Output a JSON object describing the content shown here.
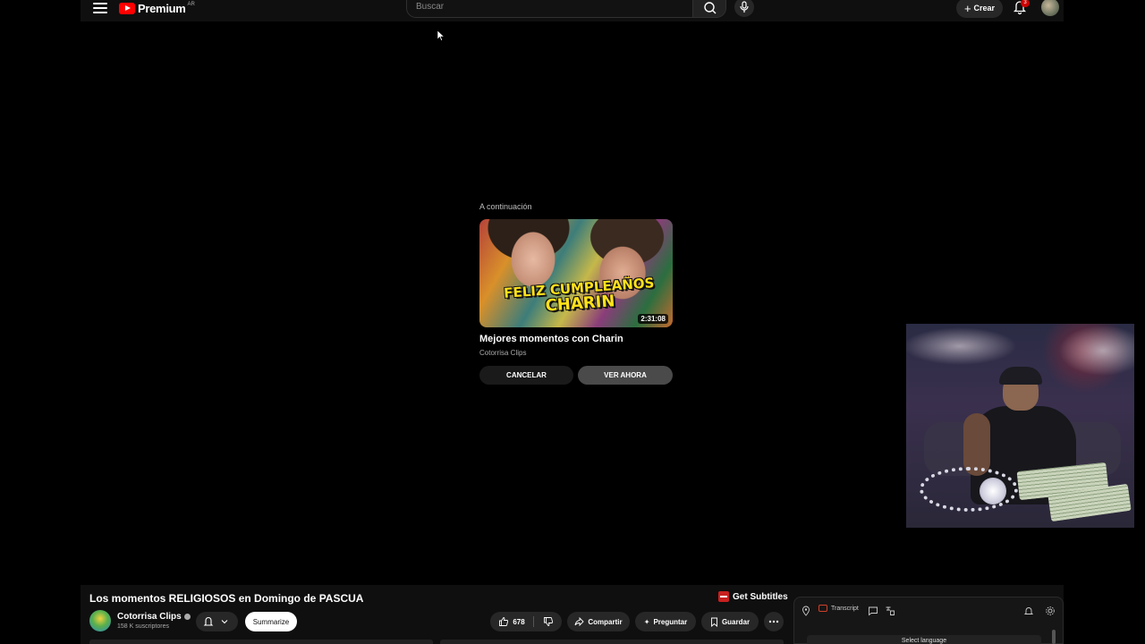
{
  "header": {
    "logo_text": "Premium",
    "country_code": "AR",
    "search_placeholder": "Buscar",
    "create_label": "Crear",
    "notification_count": "3"
  },
  "up_next": {
    "label": "A continuación",
    "thumbnail_caption_line1": "FELIZ CUMPLEAÑOS",
    "thumbnail_caption_line2": "CHARIN",
    "duration": "2:31:08",
    "title": "Mejores momentos con Charin",
    "channel": "Cotorrisa Clips",
    "cancel_label": "CANCELAR",
    "watch_label": "VER AHORA"
  },
  "video": {
    "title": "Los momentos RELIGIOSOS en Domingo de PASCUA",
    "channel_name": "Cotorrisa Clips",
    "subscribers": "158 K suscriptores",
    "summarize_label": "Summarize",
    "like_count": "678",
    "share_label": "Compartir",
    "ask_label": "Preguntar",
    "save_label": "Guardar"
  },
  "extension": {
    "get_subtitles_label": "Get Subtitles",
    "transcript_label": "Transcript",
    "select_language_label": "Select language"
  },
  "colors": {
    "brand_red": "#ff0000",
    "background": "#000000",
    "surface": "#0f0f0f",
    "pill": "#272727"
  }
}
